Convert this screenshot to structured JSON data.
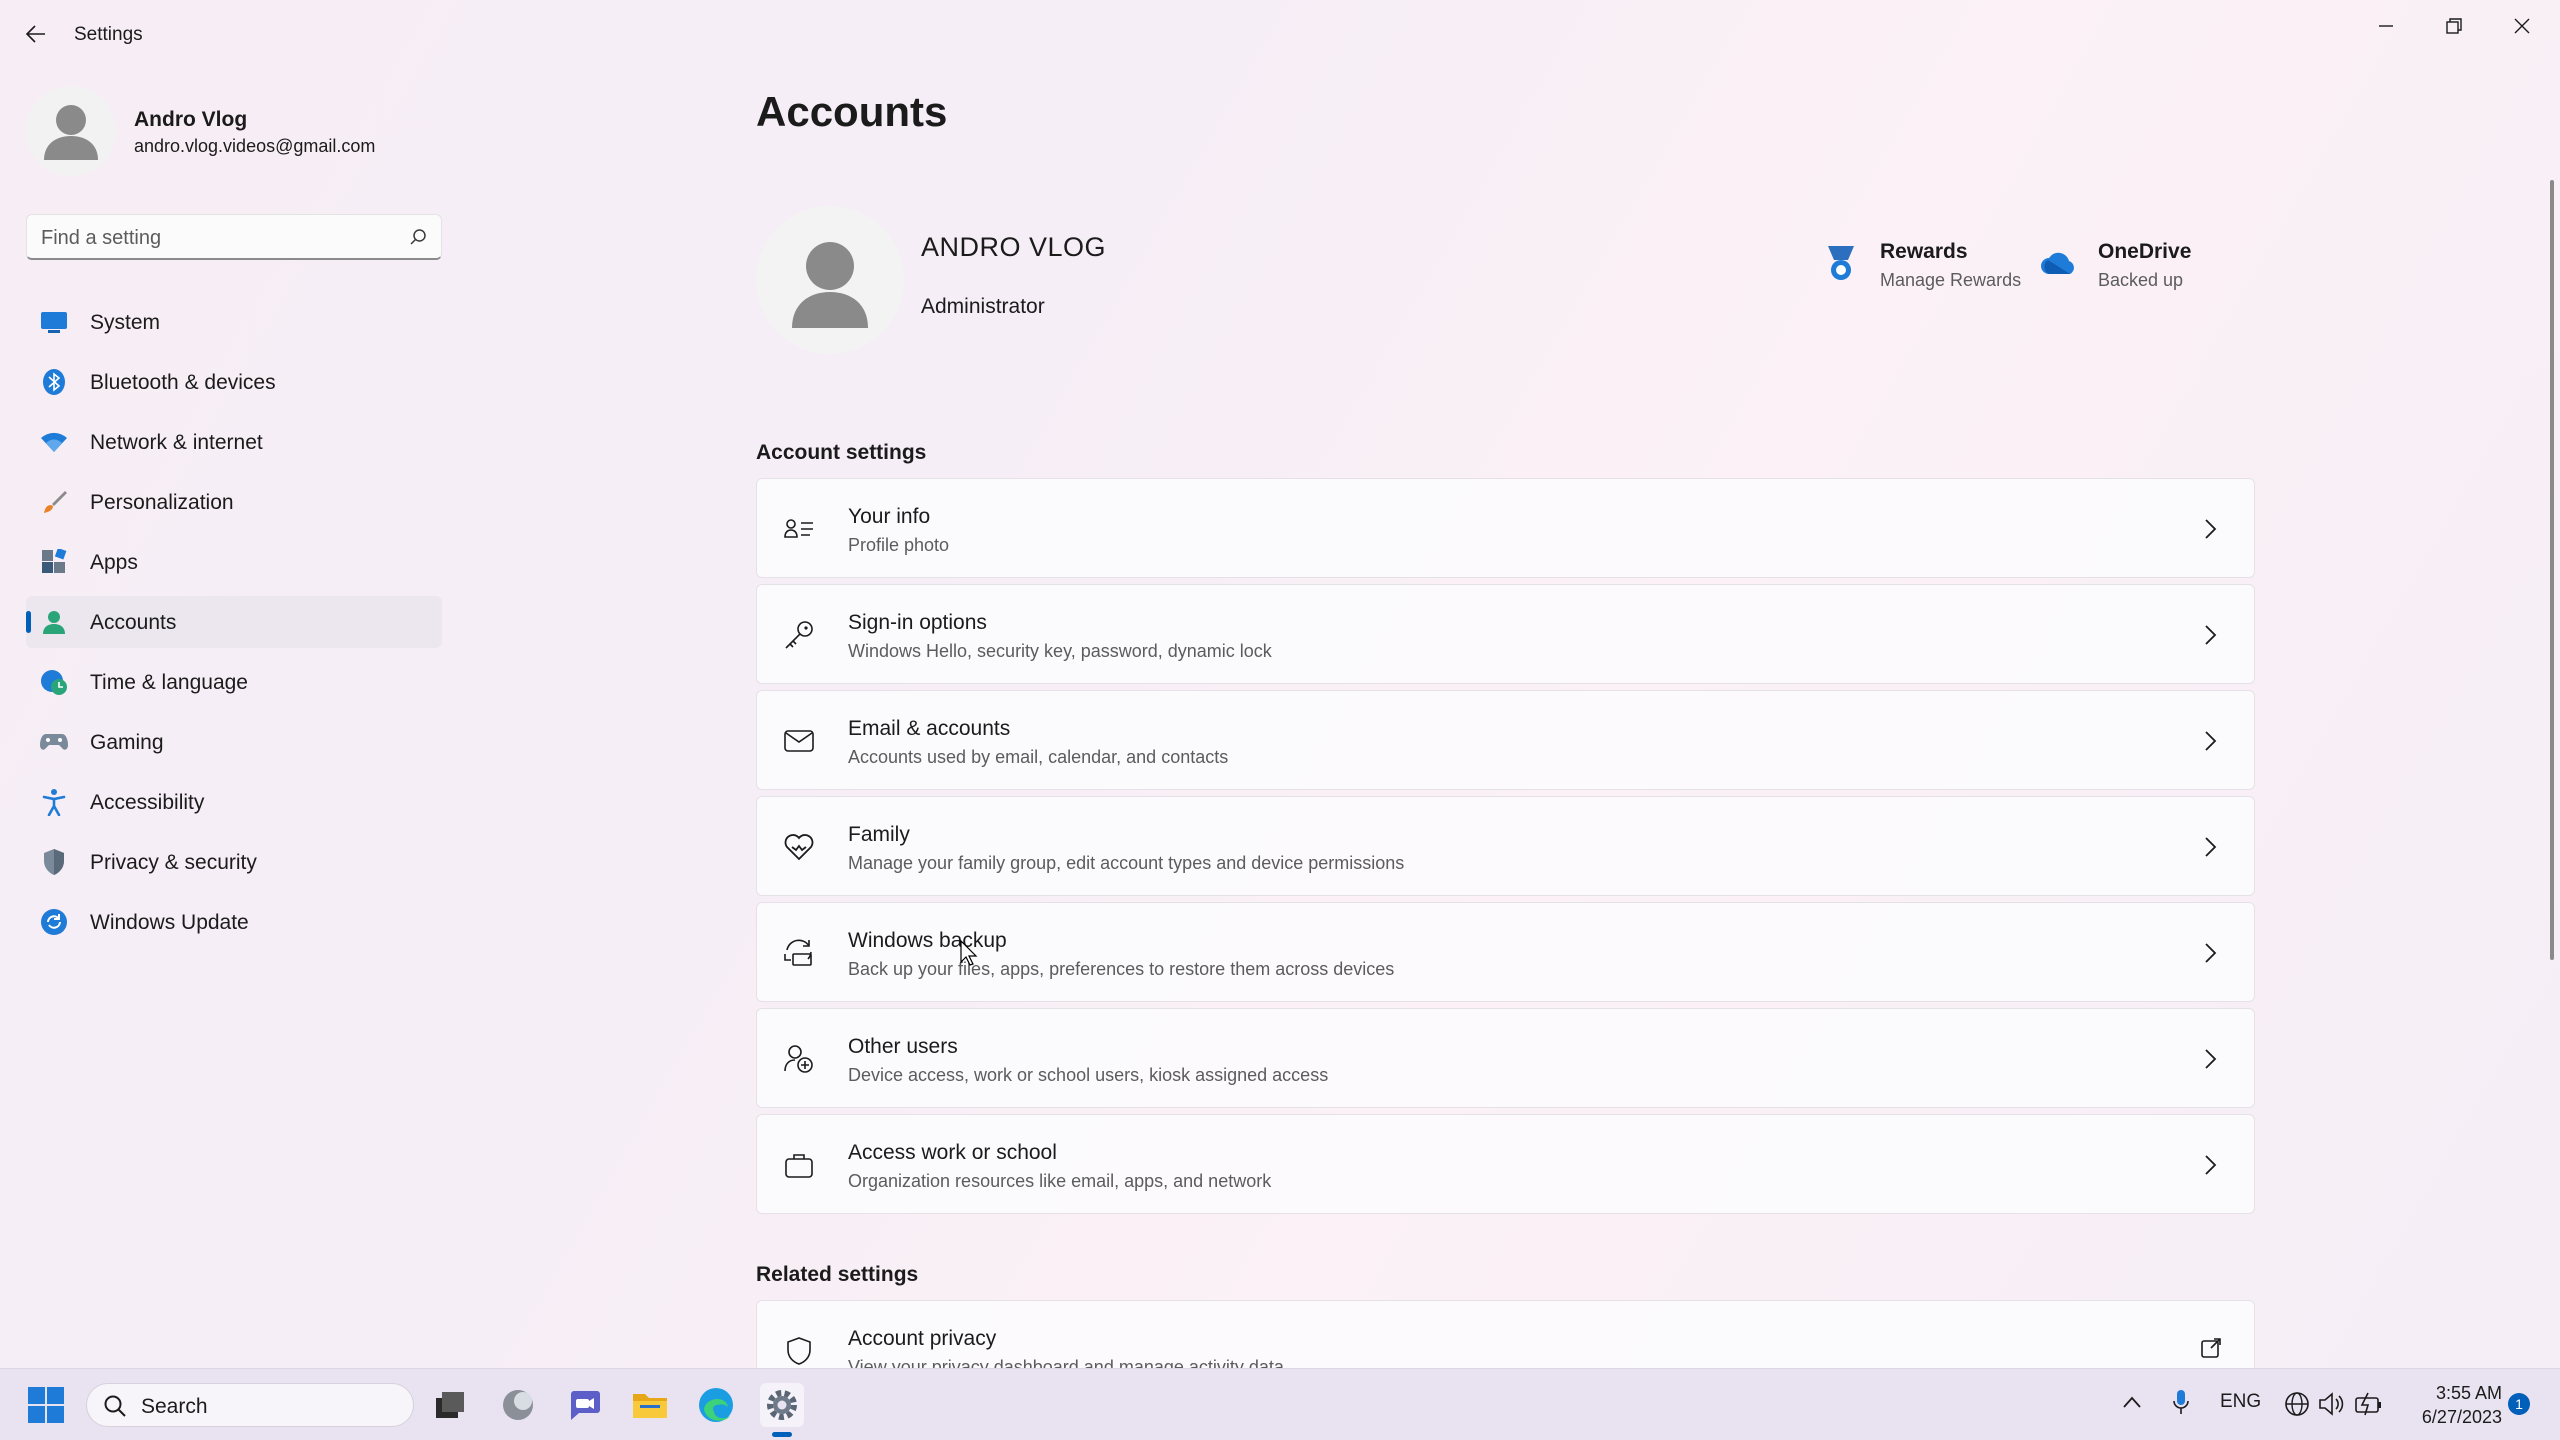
{
  "window": {
    "title": "Settings"
  },
  "profile": {
    "name": "Andro Vlog",
    "email": "andro.vlog.videos@gmail.com"
  },
  "search": {
    "placeholder": "Find a setting"
  },
  "sidebar": {
    "items": [
      {
        "label": "System",
        "icon": "monitor-icon"
      },
      {
        "label": "Bluetooth & devices",
        "icon": "bluetooth-icon"
      },
      {
        "label": "Network & internet",
        "icon": "wifi-icon"
      },
      {
        "label": "Personalization",
        "icon": "brush-icon"
      },
      {
        "label": "Apps",
        "icon": "apps-icon"
      },
      {
        "label": "Accounts",
        "icon": "person-icon",
        "active": true
      },
      {
        "label": "Time & language",
        "icon": "globe-clock-icon"
      },
      {
        "label": "Gaming",
        "icon": "gamepad-icon"
      },
      {
        "label": "Accessibility",
        "icon": "accessibility-icon"
      },
      {
        "label": "Privacy & security",
        "icon": "shield-icon"
      },
      {
        "label": "Windows Update",
        "icon": "update-icon"
      }
    ]
  },
  "main": {
    "title": "Accounts",
    "account": {
      "name": "ANDRO VLOG",
      "role": "Administrator"
    },
    "rewards": {
      "title": "Rewards",
      "subtitle": "Manage Rewards"
    },
    "onedrive": {
      "title": "OneDrive",
      "subtitle": "Backed up"
    },
    "account_settings_title": "Account settings",
    "cards": [
      {
        "title": "Your info",
        "subtitle": "Profile photo",
        "icon": "person-card-icon"
      },
      {
        "title": "Sign-in options",
        "subtitle": "Windows Hello, security key, password, dynamic lock",
        "icon": "key-icon"
      },
      {
        "title": "Email & accounts",
        "subtitle": "Accounts used by email, calendar, and contacts",
        "icon": "mail-icon"
      },
      {
        "title": "Family",
        "subtitle": "Manage your family group, edit account types and device permissions",
        "icon": "family-heart-icon"
      },
      {
        "title": "Windows backup",
        "subtitle": "Back up your files, apps, preferences to restore them across devices",
        "icon": "backup-icon"
      },
      {
        "title": "Other users",
        "subtitle": "Device access, work or school users, kiosk assigned access",
        "icon": "add-user-icon"
      },
      {
        "title": "Access work or school",
        "subtitle": "Organization resources like email, apps, and network",
        "icon": "briefcase-icon"
      }
    ],
    "related_settings_title": "Related settings",
    "related": [
      {
        "title": "Account privacy",
        "subtitle": "View your privacy dashboard and manage activity data",
        "icon": "shield-outline-icon"
      }
    ]
  },
  "taskbar": {
    "search_label": "Search",
    "tray": {
      "language": "ENG"
    },
    "clock": {
      "time": "3:55 AM",
      "date": "6/27/2023"
    },
    "notifications": "1"
  },
  "colors": {
    "accent": "#005fb8"
  }
}
